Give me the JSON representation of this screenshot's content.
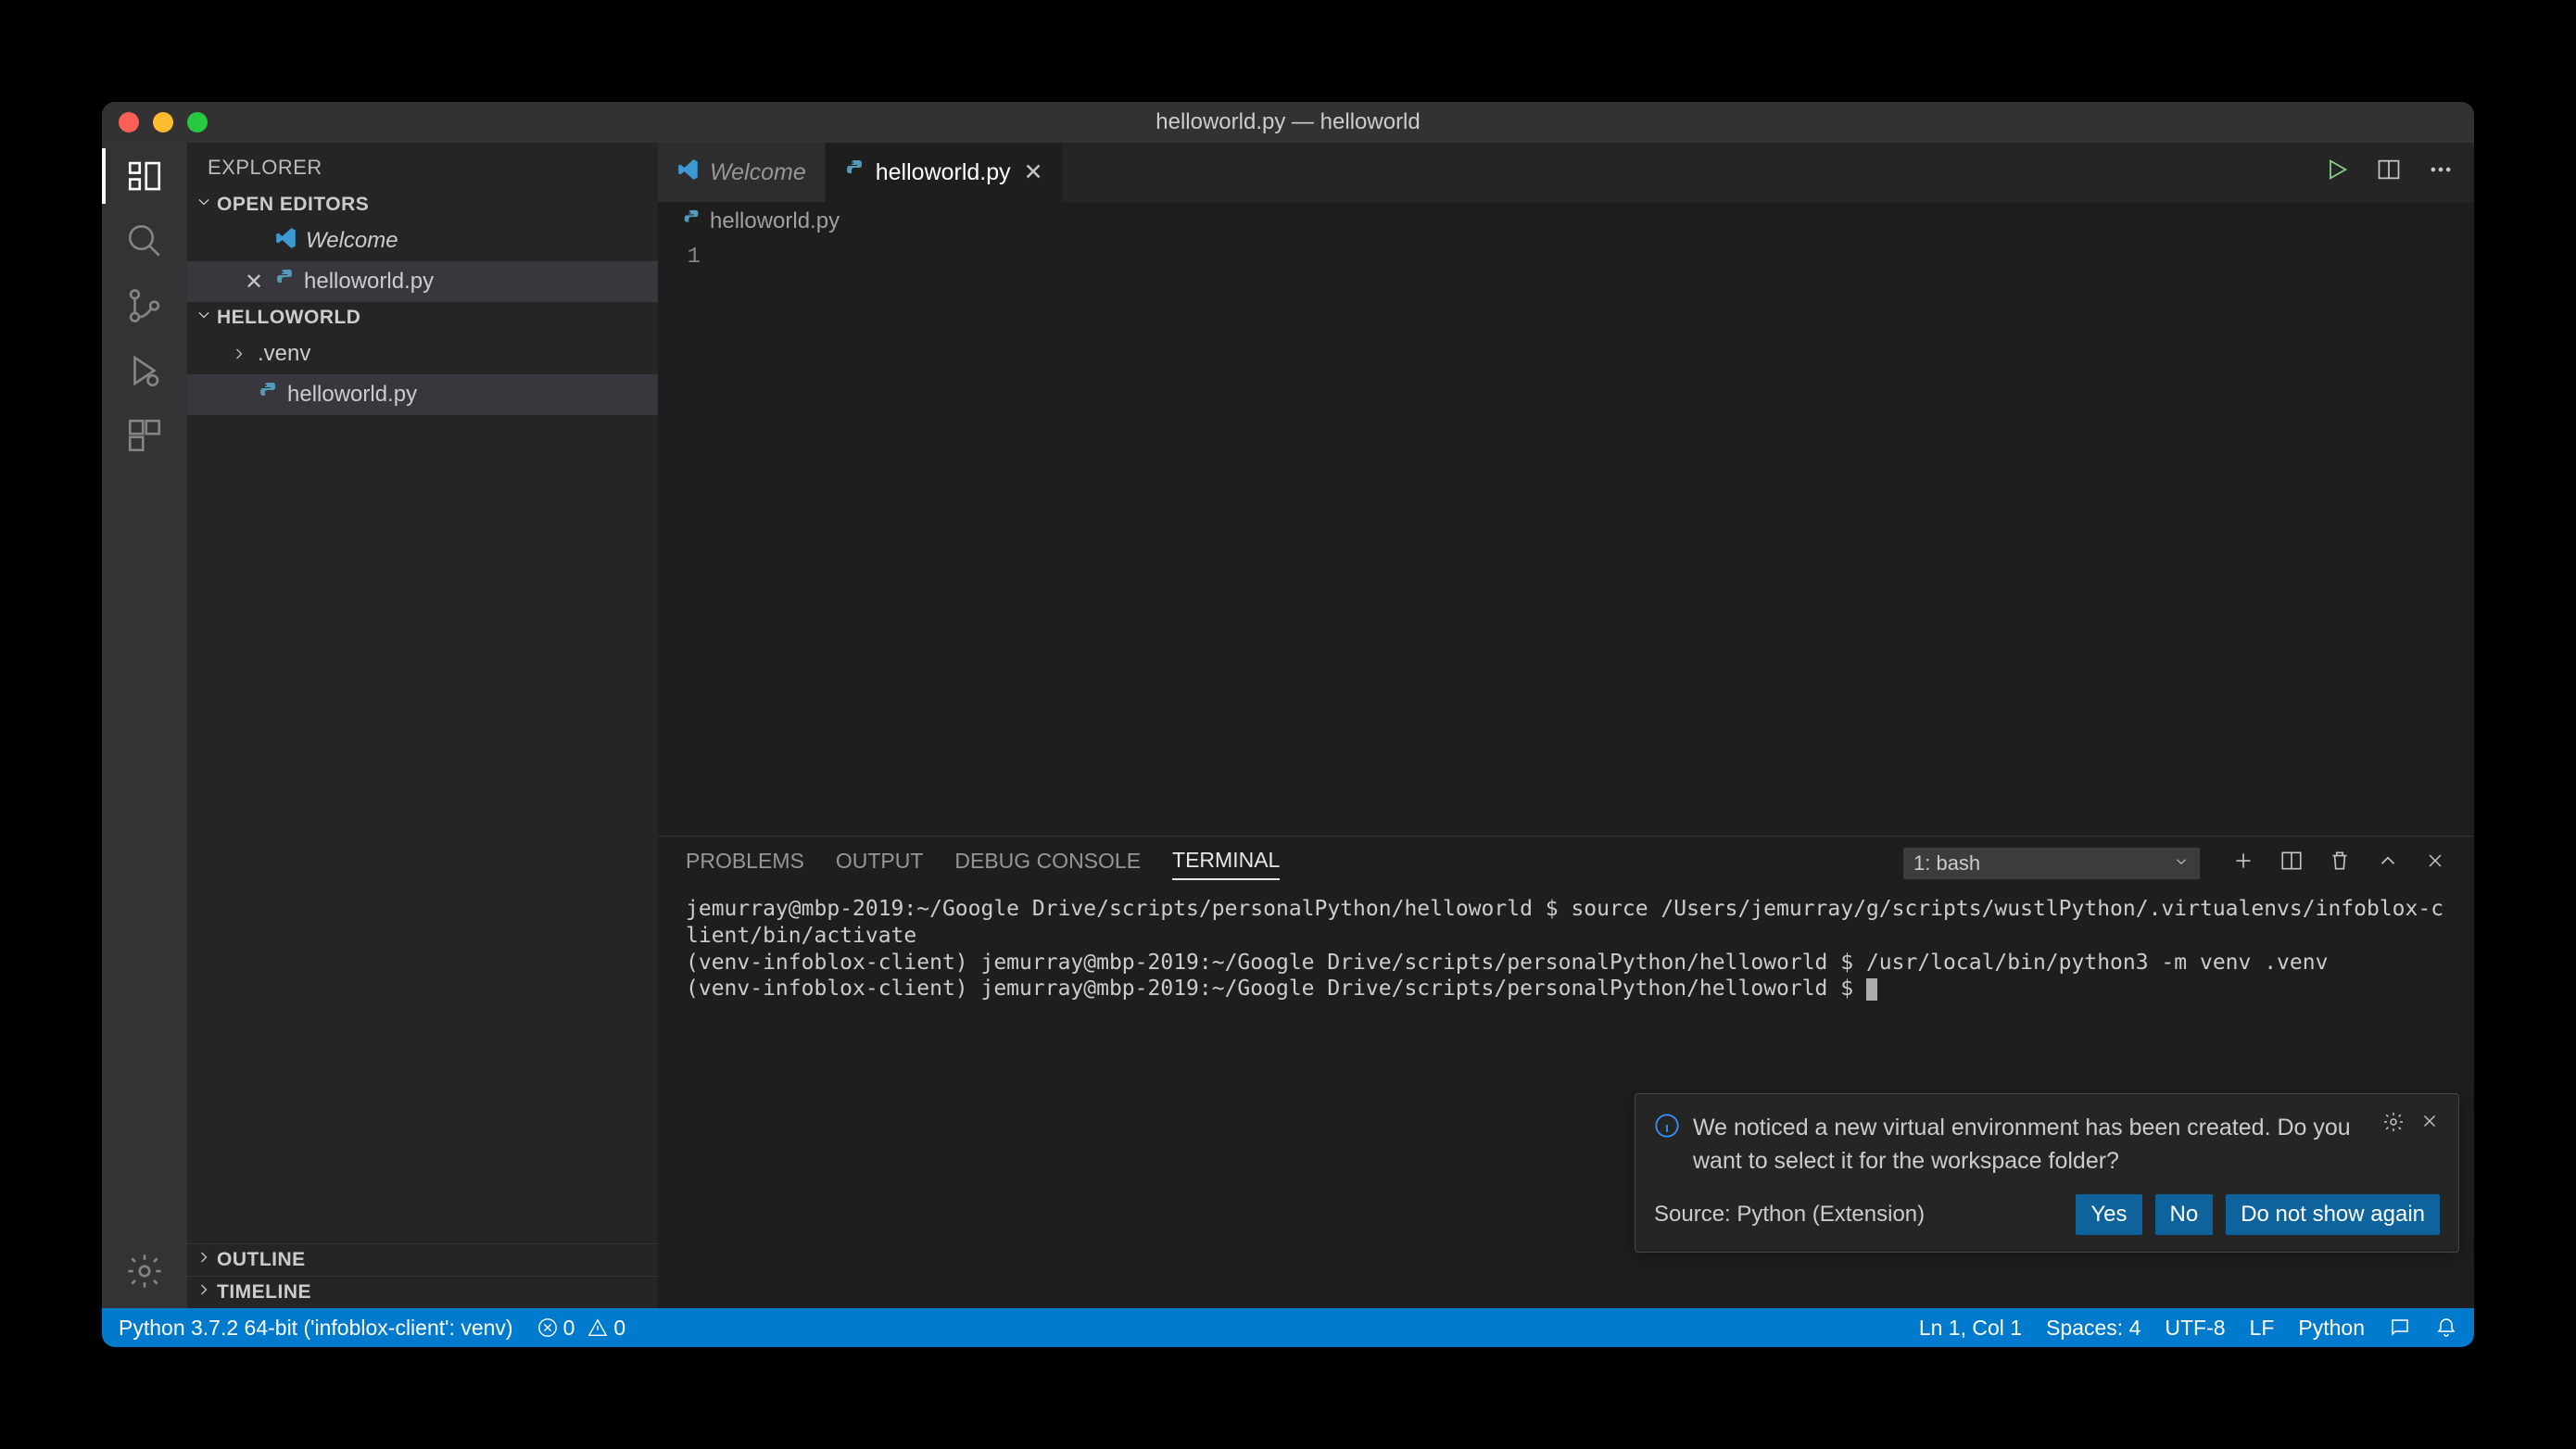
{
  "window": {
    "title": "helloworld.py — helloworld"
  },
  "sidebar": {
    "title": "EXPLORER",
    "openEditors": {
      "header": "OPEN EDITORS",
      "items": [
        {
          "label": "Welcome",
          "icon": "vscode",
          "italic": true,
          "unsaved": false
        },
        {
          "label": "helloworld.py",
          "icon": "python",
          "italic": false,
          "unsaved": false,
          "active": true
        }
      ]
    },
    "workspace": {
      "header": "HELLOWORLD",
      "items": [
        {
          "label": ".venv",
          "type": "folder"
        },
        {
          "label": "helloworld.py",
          "type": "file",
          "icon": "python",
          "active": true
        }
      ]
    },
    "outline": "OUTLINE",
    "timeline": "TIMELINE"
  },
  "tabs": {
    "items": [
      {
        "label": "Welcome",
        "icon": "vscode",
        "italic": true,
        "active": false
      },
      {
        "label": "helloworld.py",
        "icon": "python",
        "active": true
      }
    ]
  },
  "breadcrumb": {
    "file": "helloworld.py"
  },
  "editor": {
    "lineNumber": "1",
    "content": ""
  },
  "panel": {
    "tabs": {
      "problems": "PROBLEMS",
      "output": "OUTPUT",
      "debug": "DEBUG CONSOLE",
      "terminal": "TERMINAL"
    },
    "termSelect": "1: bash",
    "terminalLines": "jemurray@mbp-2019:~/Google Drive/scripts/personalPython/helloworld $ source /Users/jemurray/g/scripts/wustlPython/.virtualenvs/infoblox-client/bin/activate\n(venv-infoblox-client) jemurray@mbp-2019:~/Google Drive/scripts/personalPython/helloworld $ /usr/local/bin/python3 -m venv .venv\n(venv-infoblox-client) jemurray@mbp-2019:~/Google Drive/scripts/personalPython/helloworld $ "
  },
  "notification": {
    "message": "We noticed a new virtual environment has been created. Do you want to select it for the workspace folder?",
    "source": "Source: Python (Extension)",
    "yes": "Yes",
    "no": "No",
    "dontShow": "Do not show again"
  },
  "statusbar": {
    "python": "Python 3.7.2 64-bit ('infoblox-client': venv)",
    "errors": "0",
    "warnings": "0",
    "lncol": "Ln 1, Col 1",
    "spaces": "Spaces: 4",
    "encoding": "UTF-8",
    "eol": "LF",
    "lang": "Python"
  }
}
